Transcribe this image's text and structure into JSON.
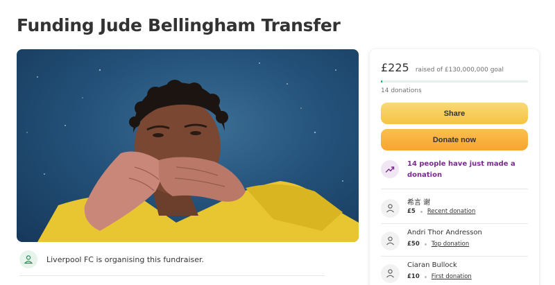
{
  "page": {
    "title": "Funding Jude Bellingham Transfer"
  },
  "organiser": {
    "text": "Liverpool FC is organising this fundraiser.",
    "icon": "person-icon"
  },
  "summary": {
    "amount": "£225",
    "raised_of": "raised of £130,000,000 goal",
    "progress_fraction": 2e-06,
    "donations": "14 donations"
  },
  "buttons": {
    "share": "Share",
    "donate": "Donate now"
  },
  "trend": {
    "text": "14 people have just made a donation",
    "icon": "trending-up-icon"
  },
  "donors": [
    {
      "name": "希言 谢",
      "amount": "£5",
      "tag": "Recent donation"
    },
    {
      "name": "Andri Thor Andresson",
      "amount": "£50",
      "tag": "Top donation"
    },
    {
      "name": "Ciaran Bullock",
      "amount": "£10",
      "tag": "First donation"
    }
  ],
  "colors": {
    "share_button": "#f5c441",
    "donate_button": "#f7a531",
    "trend_text": "#7a2a8f",
    "progress": "#02a95c"
  }
}
